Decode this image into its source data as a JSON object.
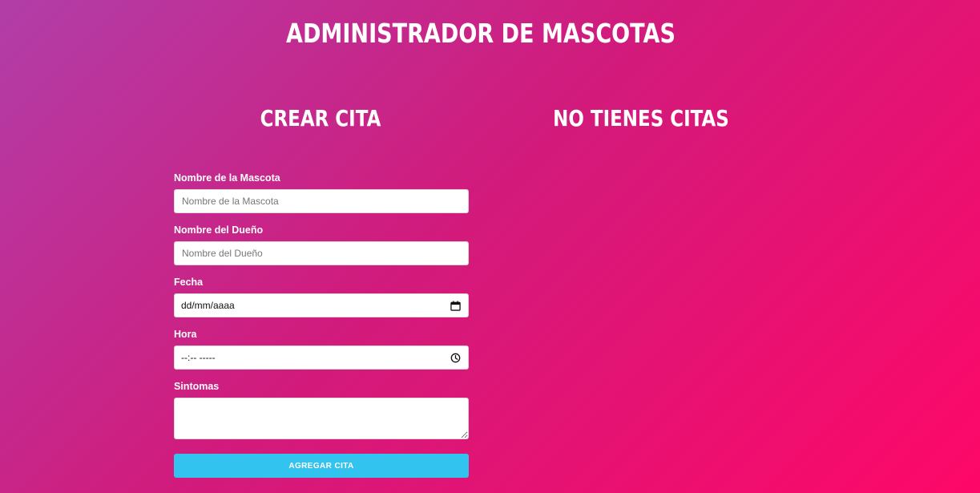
{
  "app": {
    "title": "ADMINISTRADOR DE MASCOTAS"
  },
  "form_section": {
    "title": "CREAR CITA"
  },
  "list_section": {
    "title": "NO TIENES CITAS"
  },
  "form": {
    "pet_name": {
      "label": "Nombre de la Mascota",
      "placeholder": "Nombre de la Mascota",
      "value": ""
    },
    "owner_name": {
      "label": "Nombre del Dueño",
      "placeholder": "Nombre del Dueño",
      "value": ""
    },
    "date": {
      "label": "Fecha",
      "display": "dd/mm/aaaa",
      "icon": "calendar-icon"
    },
    "time": {
      "label": "Hora",
      "display": "--:-- -----",
      "icon": "clock-icon"
    },
    "symptoms": {
      "label": "Sintomas",
      "value": ""
    },
    "submit_label": "AGREGAR CITA"
  },
  "colors": {
    "gradient_start": "#b13ea8",
    "gradient_end": "#fe0868",
    "button": "#33c3ef"
  }
}
